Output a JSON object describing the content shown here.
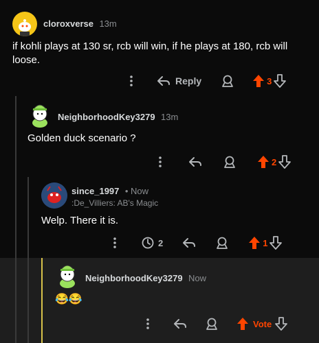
{
  "comments": [
    {
      "username": "cloroxverse",
      "time": "13m",
      "body": "if kohli plays at 130 sr, rcb will win, if he plays at 180, rcb will loose.",
      "reply_label": "Reply",
      "votes": "3"
    },
    {
      "username": "NeighborhoodKey3279",
      "time": "13m",
      "body": "Golden duck scenario ?",
      "votes": "2"
    },
    {
      "username": "since_1997",
      "time": "• Now",
      "flair": ":De_Villiers: AB's Magic",
      "body": "Welp. There it is.",
      "awards": "2",
      "votes": "1"
    },
    {
      "username": "NeighborhoodKey3279",
      "time": "Now",
      "body": "😂😂",
      "vote_label": "Vote"
    }
  ],
  "colors": {
    "upvote": "#ff4500",
    "background": "#0b0b0b",
    "highlight": "#1e1e1e"
  }
}
